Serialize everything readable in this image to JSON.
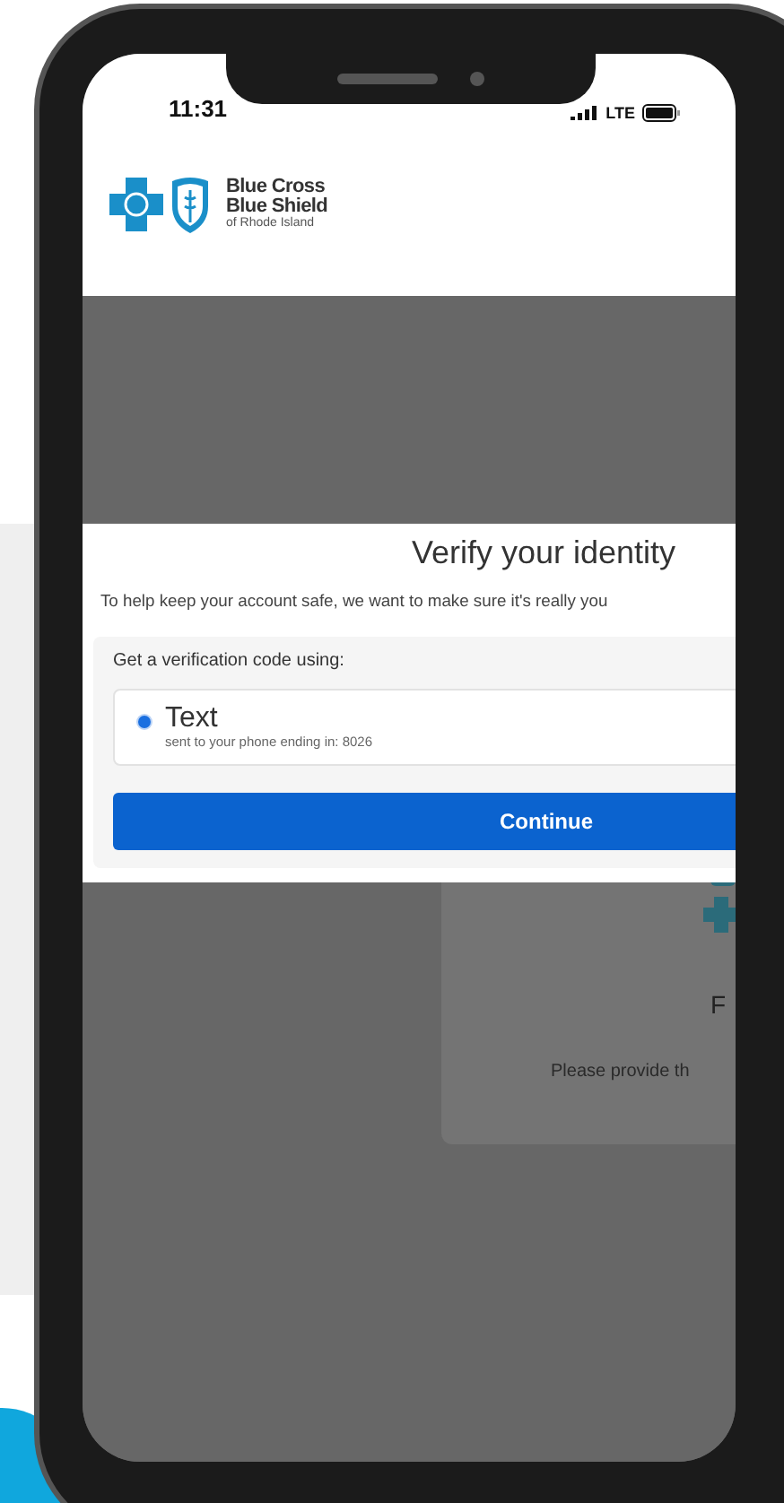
{
  "status_bar": {
    "time": "11:31",
    "network": "LTE"
  },
  "header": {
    "logo_lines": [
      "Blue Cross",
      "Blue Shield",
      "of Rhode Island"
    ]
  },
  "dialog": {
    "title": "Verify your identity",
    "subtitle": "To help keep your account safe, we want to make sure it's really you",
    "section_label": "Get a verification code using:",
    "options": [
      {
        "label": "Text",
        "detail": "sent to your phone ending in: 8026",
        "selected": true
      }
    ],
    "button": "Continue"
  },
  "background_card": {
    "title": "F",
    "text": "Please provide th"
  }
}
